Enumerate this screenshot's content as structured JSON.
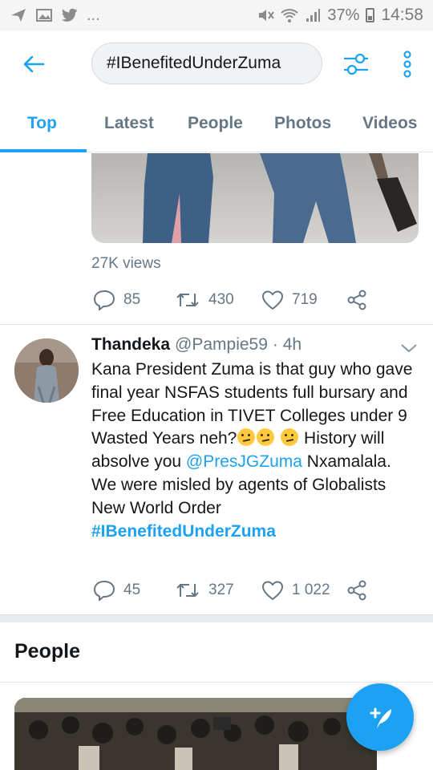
{
  "status_bar": {
    "battery": "37%",
    "time": "14:58",
    "overflow": "..."
  },
  "search": {
    "query": "#IBenefitedUnderZuma"
  },
  "tabs": [
    {
      "label": "Top"
    },
    {
      "label": "Latest"
    },
    {
      "label": "People"
    },
    {
      "label": "Photos"
    },
    {
      "label": "Videos"
    }
  ],
  "prev_tweet": {
    "views": "27K views",
    "replies": "85",
    "retweets": "430",
    "likes": "719"
  },
  "tweet": {
    "name": "Thandeka",
    "handle": "@Pampie59",
    "time": "· 4h",
    "text_1": "Kana President Zuma is that guy who gave final year NSFAS students full bursary and Free Education in TIVET Colleges under 9 Wasted Years neh?",
    "text_2": " History will absolve you ",
    "mention": "@PresJGZuma",
    "text_3": " Nxamalala. We were misled by agents of Globalists New World Order",
    "hashtag": "#IBenefitedUnderZuma",
    "replies": "45",
    "retweets": "327",
    "likes": "1 022"
  },
  "people": {
    "title": "People"
  },
  "colors": {
    "accent": "#1da1f2",
    "muted": "#657786",
    "text": "#14171a"
  },
  "icons": [
    "back-arrow-icon",
    "filter-sliders-icon",
    "more-vertical-icon",
    "reply-icon",
    "retweet-icon",
    "like-heart-icon",
    "share-icon",
    "chevron-down-icon",
    "compose-tweet-icon"
  ]
}
